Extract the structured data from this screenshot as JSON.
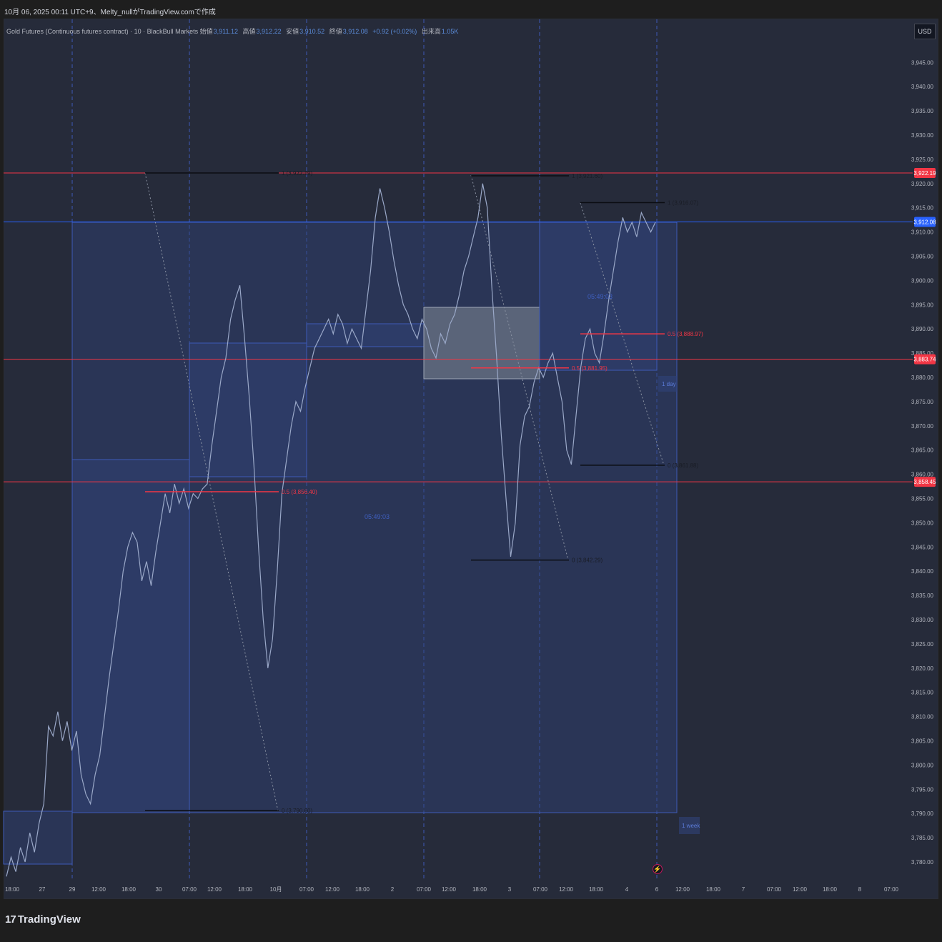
{
  "header": {
    "caption": "10月 06, 2025 00:11 UTC+9、Melty_nullがTradingView.comで作成"
  },
  "legend": {
    "symbol": "Gold Futures (Continuous futures contract) · 10 · BlackBull Markets",
    "open_label": "始値",
    "open": "3,911.12",
    "high_label": "高値",
    "high": "3,912.22",
    "low_label": "安値",
    "low": "3,910.52",
    "close_label": "終値",
    "close": "3,912.08",
    "change": "+0.92 (+0.02%)",
    "volume_label": "出来高",
    "volume": "1.05K"
  },
  "currency": "USD",
  "brand": {
    "name": "TradingView",
    "mark": "17",
    "flash_icon": "lightning-icon"
  },
  "colors": {
    "background": "#262b3a",
    "price": "#9aa8c8",
    "red_line": "#f23645",
    "blue_line": "#3d5ab8",
    "box_fill": "#30437a"
  },
  "chart_data": {
    "type": "line",
    "title": "",
    "ylim": [
      3776,
      3950
    ],
    "y_ticks": [
      {
        "v": 3945,
        "l": "3,945.00"
      },
      {
        "v": 3940,
        "l": "3,940.00"
      },
      {
        "v": 3935,
        "l": "3,935.00"
      },
      {
        "v": 3930,
        "l": "3,930.00"
      },
      {
        "v": 3925,
        "l": "3,925.00"
      },
      {
        "v": 3920,
        "l": "3,920.00"
      },
      {
        "v": 3915,
        "l": "3,915.00"
      },
      {
        "v": 3910,
        "l": "3,910.00"
      },
      {
        "v": 3905,
        "l": "3,905.00"
      },
      {
        "v": 3900,
        "l": "3,900.00"
      },
      {
        "v": 3895,
        "l": "3,895.00"
      },
      {
        "v": 3890,
        "l": "3,890.00"
      },
      {
        "v": 3885,
        "l": "3,885.00"
      },
      {
        "v": 3880,
        "l": "3,880.00"
      },
      {
        "v": 3875,
        "l": "3,875.00"
      },
      {
        "v": 3870,
        "l": "3,870.00"
      },
      {
        "v": 3865,
        "l": "3,865.00"
      },
      {
        "v": 3860,
        "l": "3,860.00"
      },
      {
        "v": 3855,
        "l": "3,855.00"
      },
      {
        "v": 3850,
        "l": "3,850.00"
      },
      {
        "v": 3845,
        "l": "3,845.00"
      },
      {
        "v": 3840,
        "l": "3,840.00"
      },
      {
        "v": 3835,
        "l": "3,835.00"
      },
      {
        "v": 3830,
        "l": "3,830.00"
      },
      {
        "v": 3825,
        "l": "3,825.00"
      },
      {
        "v": 3820,
        "l": "3,820.00"
      },
      {
        "v": 3815,
        "l": "3,815.00"
      },
      {
        "v": 3810,
        "l": "3,810.00"
      },
      {
        "v": 3805,
        "l": "3,805.00"
      },
      {
        "v": 3800,
        "l": "3,800.00"
      },
      {
        "v": 3795,
        "l": "3,795.00"
      },
      {
        "v": 3790,
        "l": "3,790.00"
      },
      {
        "v": 3785,
        "l": "3,785.00"
      },
      {
        "v": 3780,
        "l": "3,780.00"
      }
    ],
    "x_ticks": [
      "18:00",
      "27",
      "29",
      "12:00",
      "18:00",
      "30",
      "07:00",
      "12:00",
      "18:00",
      "10月",
      "07:00",
      "12:00",
      "18:00",
      "2",
      "07:00",
      "12:00",
      "18:00",
      "3",
      "07:00",
      "12:00",
      "18:00",
      "4",
      "6",
      "12:00",
      "18:00",
      "7",
      "07:00",
      "12:00",
      "18:00",
      "8",
      "07:00"
    ],
    "price_badges": [
      {
        "price": 3922.19,
        "label": "3,922.19",
        "color": "#f23645"
      },
      {
        "price": 3912.08,
        "label": "3,912.08",
        "color": "#2962ff"
      },
      {
        "price": 3883.74,
        "label": "3,883.74",
        "color": "#f23645"
      },
      {
        "price": 3858.45,
        "label": "3,858.45",
        "color": "#f23645"
      }
    ],
    "horizontal_lines": [
      {
        "price": 3922.19,
        "color": "#f23645"
      },
      {
        "price": 3912.08,
        "color": "#2962ff"
      },
      {
        "price": 3883.74,
        "color": "#f23645"
      },
      {
        "price": 3858.45,
        "color": "#f23645"
      }
    ],
    "fib_levels": [
      {
        "price": 3922.19,
        "label": "1 (3,922.19)",
        "color": "#000000"
      },
      {
        "price": 3856.4,
        "label": "0.5 (3,856.40)",
        "color": "#f23645"
      },
      {
        "price": 3790.6,
        "label": "0 (3,790.60)",
        "color": "#000000"
      },
      {
        "price": 3921.6,
        "label": "1 (3,921.60)",
        "color": "#000000"
      },
      {
        "price": 3881.95,
        "label": "0.5 (3,881.95)",
        "color": "#f23645"
      },
      {
        "price": 3842.29,
        "label": "0 (3,842.29)",
        "color": "#000000"
      },
      {
        "price": 3916.07,
        "label": "1 (3,916.07)",
        "color": "#000000"
      },
      {
        "price": 3888.97,
        "label": "0.5 (3,888.97)",
        "color": "#f23645"
      },
      {
        "price": 3861.88,
        "label": "0 (3,861.88)",
        "color": "#000000"
      }
    ],
    "annotations": [
      "05:49:03",
      "05:49:03",
      "1 day",
      "1 week"
    ],
    "series": [
      {
        "values": [
          3777,
          3781,
          3778,
          3783,
          3780,
          3786,
          3782,
          3788,
          3792,
          3808,
          3806,
          3811,
          3805,
          3809,
          3803,
          3807,
          3798,
          3794,
          3792,
          3798,
          3802,
          3810,
          3818,
          3825,
          3832,
          3840,
          3845,
          3848,
          3846,
          3838,
          3842,
          3837,
          3844,
          3850,
          3856,
          3852,
          3858,
          3854,
          3857,
          3853,
          3856,
          3855,
          3857,
          3858,
          3866,
          3873,
          3880,
          3884,
          3892,
          3896,
          3899,
          3888,
          3876,
          3862,
          3845,
          3830,
          3820,
          3826,
          3840,
          3856,
          3863,
          3870,
          3875,
          3873,
          3878,
          3882,
          3886,
          3888,
          3890,
          3892,
          3889,
          3893,
          3891,
          3887,
          3890,
          3888,
          3886,
          3894,
          3902,
          3913,
          3919,
          3915,
          3910,
          3904,
          3899,
          3895,
          3893,
          3890,
          3888,
          3892,
          3890,
          3886,
          3884,
          3889,
          3887,
          3891,
          3893,
          3897,
          3902,
          3905,
          3909,
          3913,
          3920,
          3915,
          3898,
          3884,
          3868,
          3855,
          3843,
          3850,
          3866,
          3872,
          3874,
          3879,
          3882,
          3880,
          3883,
          3885,
          3880,
          3875,
          3865,
          3862,
          3872,
          3882,
          3888,
          3890,
          3885,
          3883,
          3889,
          3896,
          3902,
          3908,
          3913,
          3910,
          3912,
          3909,
          3914,
          3912,
          3910,
          3912
        ]
      }
    ]
  }
}
